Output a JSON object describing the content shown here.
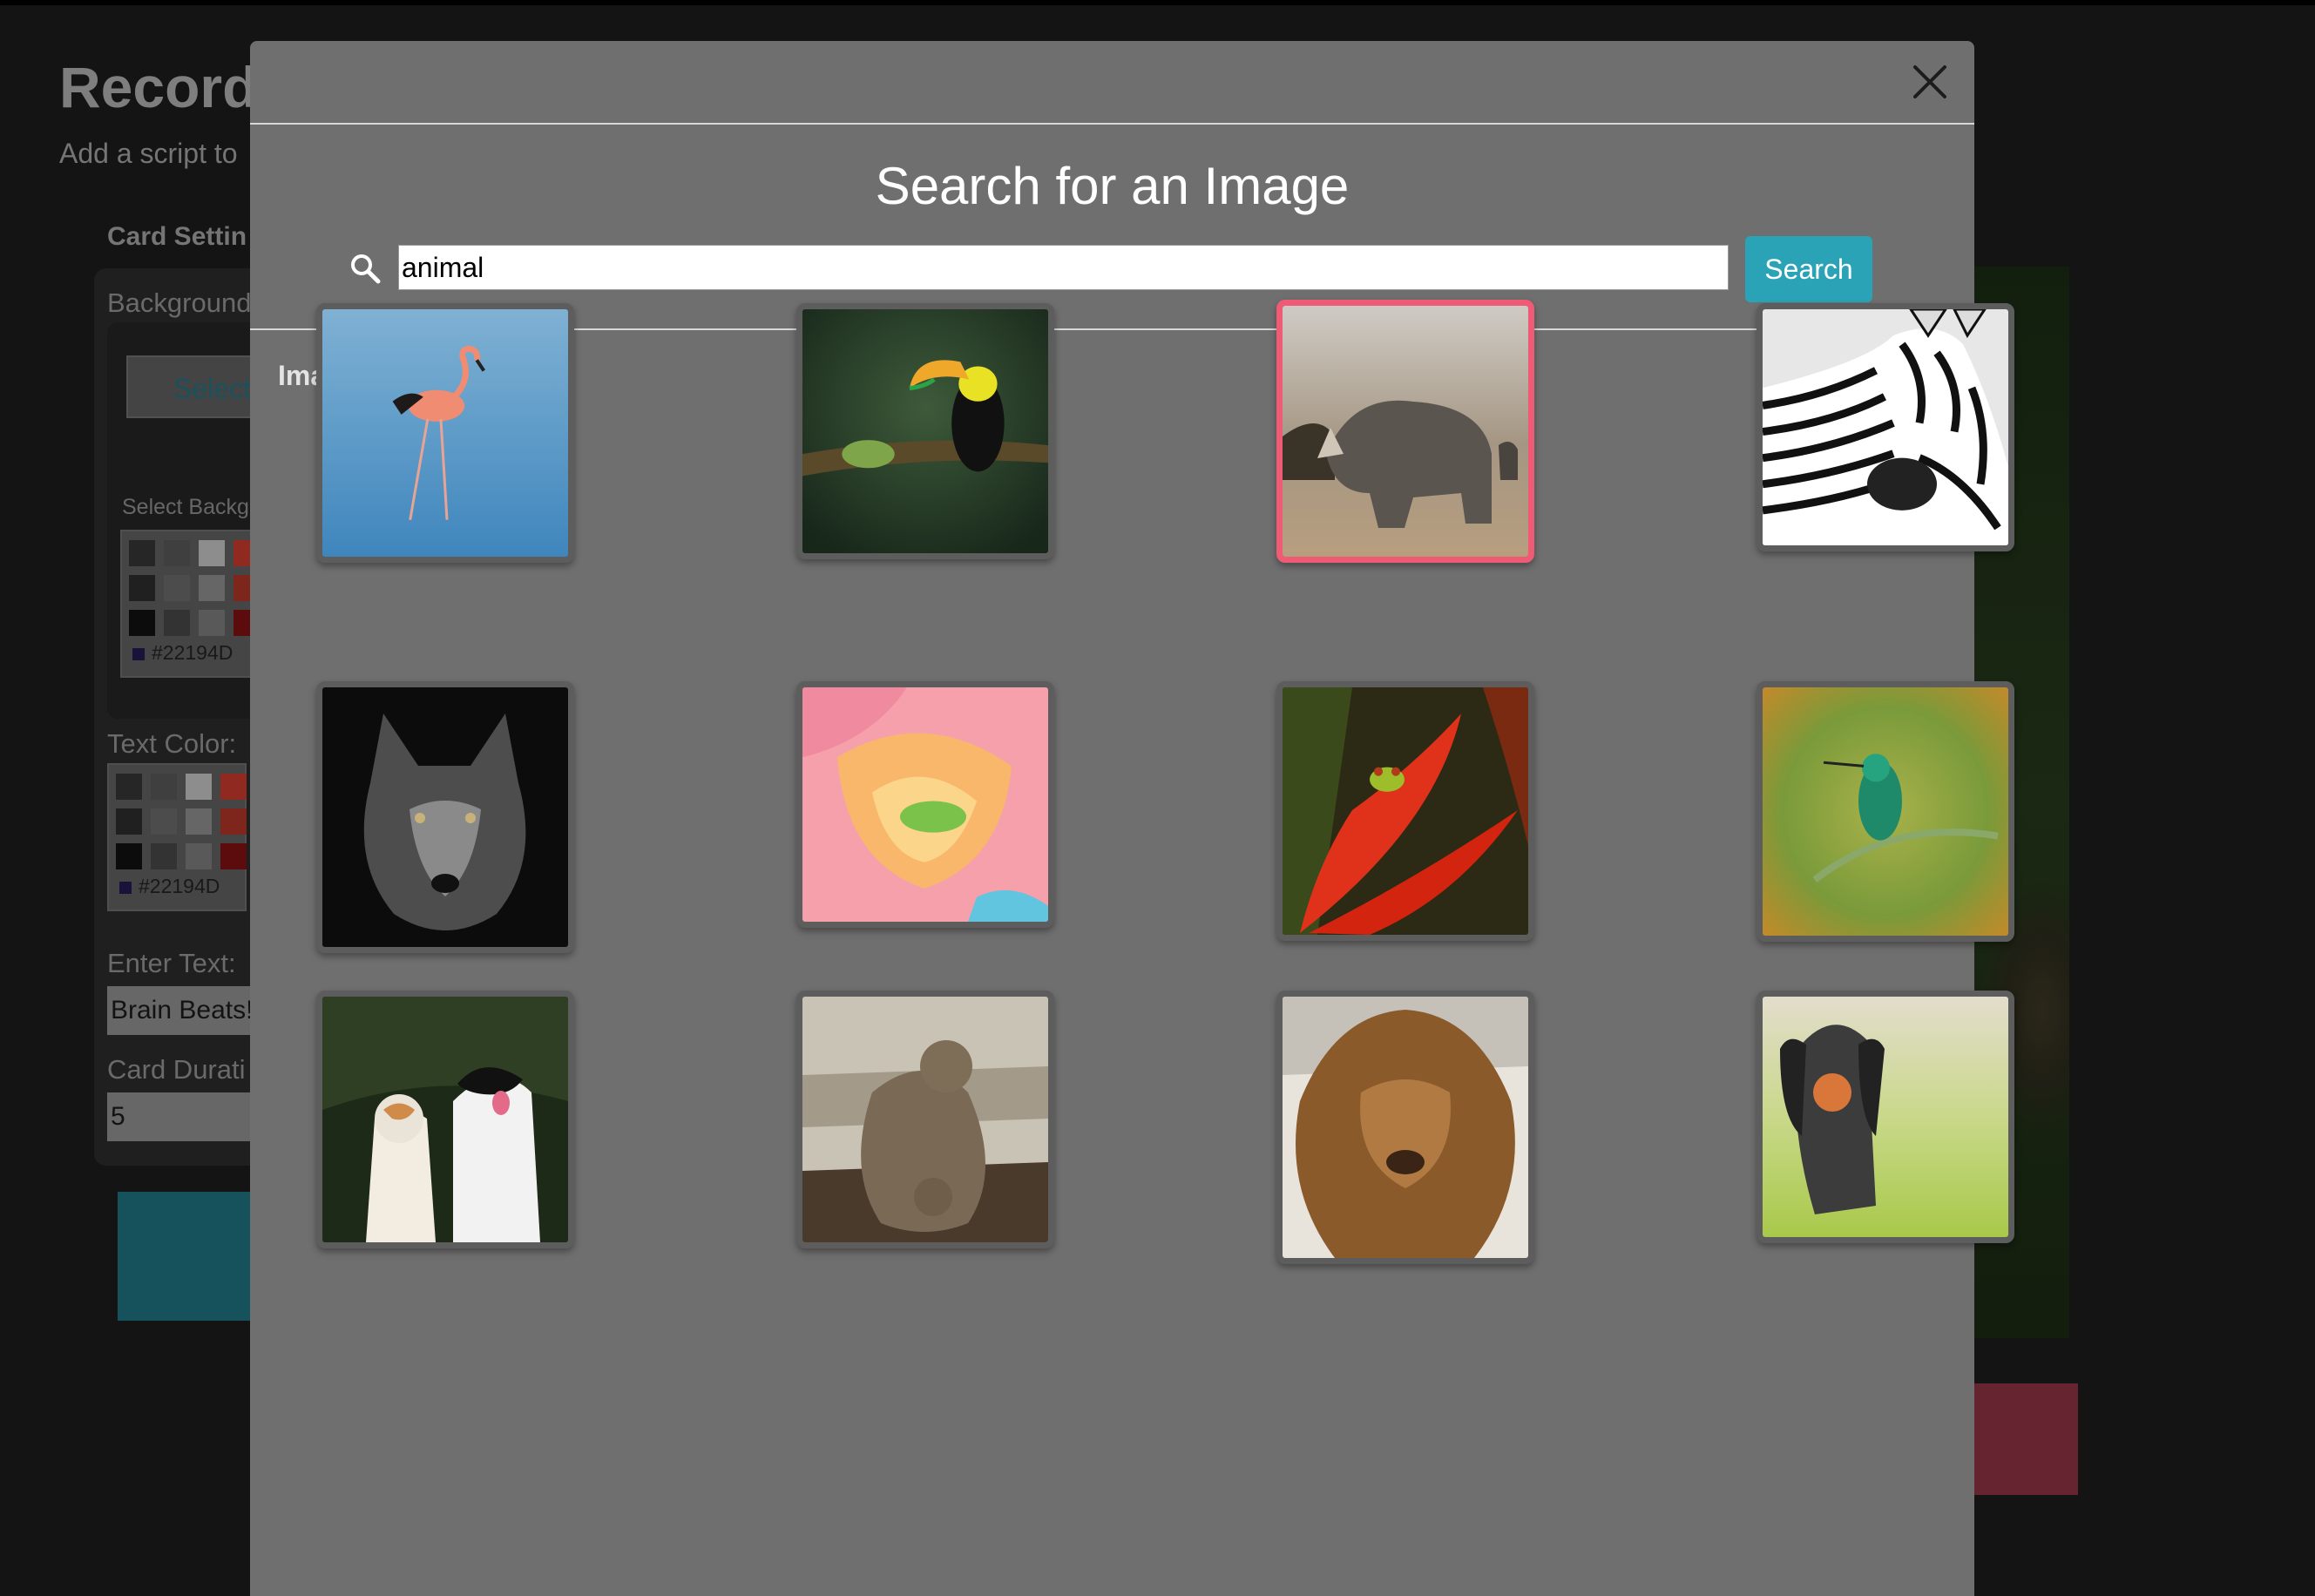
{
  "background_page": {
    "title": "Record",
    "subtitle": "Add a script to",
    "section_title": "Card Settin",
    "background_label": "Background",
    "select_button": "Select",
    "select_background_label": "Select Backg",
    "background_color_hex": "#22194D",
    "text_color_label": "Text Color:",
    "text_color_hex": "#22194D",
    "enter_text_label": "Enter Text:",
    "enter_text_value": "Brain Beats!",
    "card_duration_label": "Card Durati",
    "card_duration_value": "5",
    "swatch_colors": [
      "#333333",
      "#555555",
      "#bdbdbd",
      "#c0392b",
      "#2b2b2b",
      "#666666",
      "#888888",
      "#a93226",
      "#111111",
      "#444444",
      "#777777",
      "#7b1111"
    ]
  },
  "modal": {
    "title": "Search for an Image",
    "search": {
      "value": "animal",
      "button_label": "Search"
    },
    "results_label": "Image Results",
    "images": [
      {
        "name": "flamingo",
        "selected": false
      },
      {
        "name": "toucan",
        "selected": false
      },
      {
        "name": "rhinoceros",
        "selected": true
      },
      {
        "name": "zebra",
        "selected": false
      },
      {
        "name": "wolf",
        "selected": false
      },
      {
        "name": "frog-in-rose",
        "selected": false
      },
      {
        "name": "frog-on-heliconia",
        "selected": false
      },
      {
        "name": "hummingbird",
        "selected": false
      },
      {
        "name": "cat-and-dog",
        "selected": false
      },
      {
        "name": "quokka",
        "selected": false
      },
      {
        "name": "lion",
        "selected": false
      },
      {
        "name": "spaniel-with-ball",
        "selected": false
      }
    ]
  },
  "colors": {
    "accent_teal": "#2aa3b7",
    "selected_border": "#ef5a74",
    "modal_bg": "#6f6f6f"
  }
}
